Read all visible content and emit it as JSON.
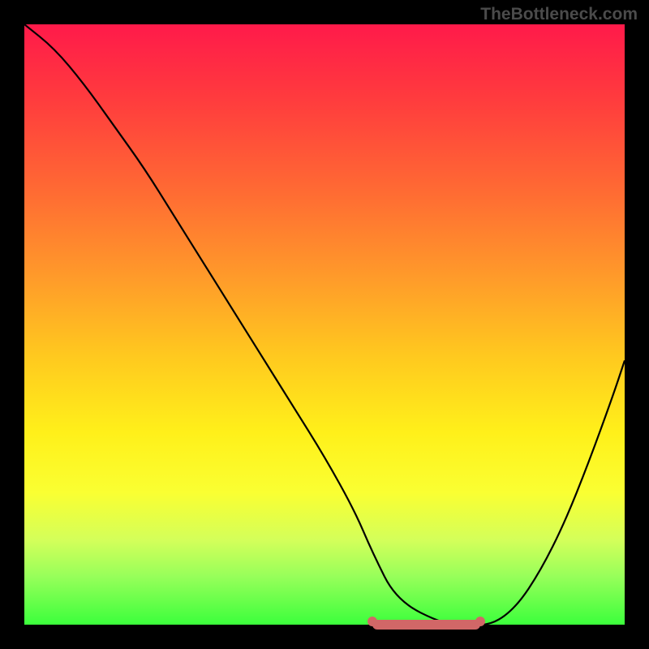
{
  "watermark": "TheBottleneck.com",
  "chart_data": {
    "type": "line",
    "title": "",
    "xlabel": "",
    "ylabel": "",
    "xlim": [
      0,
      100
    ],
    "ylim": [
      0,
      100
    ],
    "grid": false,
    "background_gradient": {
      "top_color": "#ff1a4a",
      "bottom_color": "#3cff3c",
      "description": "vertical red-to-green gradient (bottleneck severity heatmap)"
    },
    "series": [
      {
        "name": "bottleneck-curve",
        "color": "#000000",
        "x": [
          0,
          5,
          10,
          15,
          20,
          25,
          30,
          35,
          40,
          45,
          50,
          55,
          58,
          62,
          70,
          74,
          78,
          82,
          86,
          90,
          94,
          98,
          100
        ],
        "y": [
          100,
          96,
          90,
          83,
          76,
          68,
          60,
          52,
          44,
          36,
          28,
          19,
          12,
          4,
          0,
          0,
          0,
          3,
          9,
          17,
          27,
          38,
          44
        ]
      }
    ],
    "annotations": [
      {
        "name": "optimal-plateau",
        "type": "segment",
        "color": "#d16767",
        "x_start": 58,
        "x_end": 76,
        "y": 0
      }
    ]
  }
}
